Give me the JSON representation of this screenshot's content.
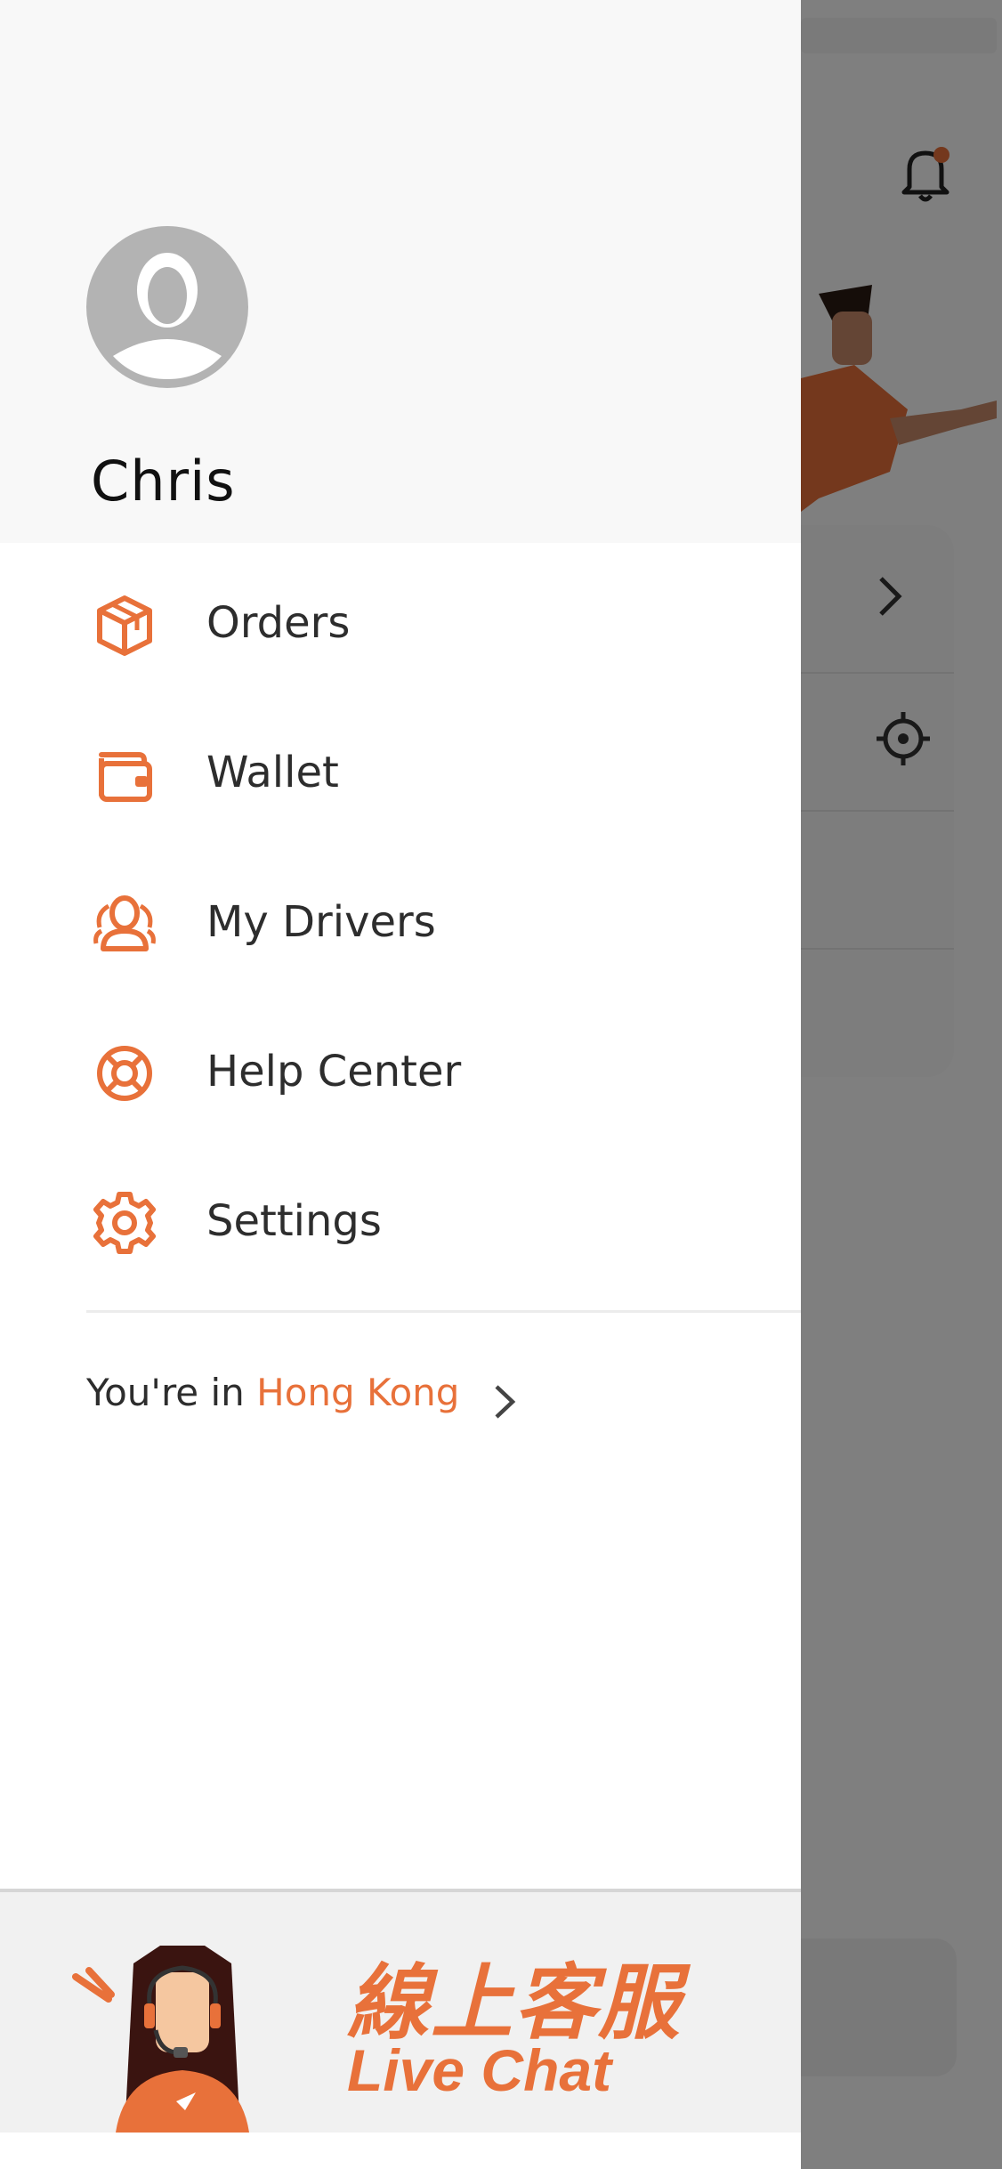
{
  "drawer": {
    "user_name": "Chris",
    "menu": [
      {
        "label": "Orders",
        "icon": "package-icon"
      },
      {
        "label": "Wallet",
        "icon": "wallet-icon"
      },
      {
        "label": "My Drivers",
        "icon": "drivers-icon"
      },
      {
        "label": "Help Center",
        "icon": "lifebuoy-icon"
      },
      {
        "label": "Settings",
        "icon": "gear-icon"
      }
    ],
    "location": {
      "prefix": "You're in ",
      "city": "Hong Kong"
    },
    "live_chat": {
      "title_cn": "線上客服",
      "title_en": "Live Chat"
    }
  },
  "colors": {
    "accent": "#e8713a",
    "text": "#2d2d2d",
    "overlay": "rgba(0,0,0,0.5)"
  }
}
